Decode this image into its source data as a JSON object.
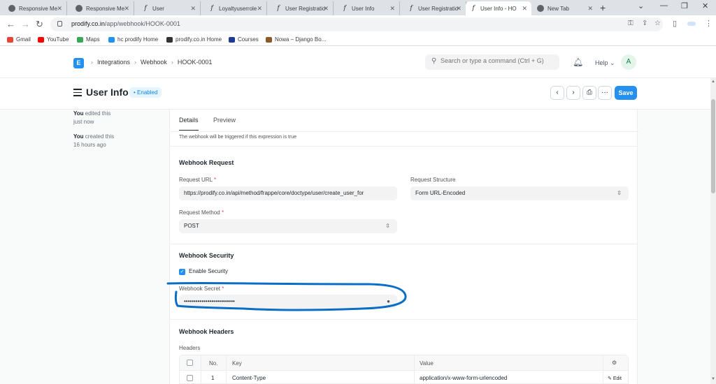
{
  "browser": {
    "tabs": [
      {
        "title": "Responsive Me",
        "icon": "globe-icon"
      },
      {
        "title": "Responsive Me",
        "icon": "globe-icon"
      },
      {
        "title": "User",
        "icon": "frappe-icon"
      },
      {
        "title": "Loyaltyuserrole",
        "icon": "frappe-icon"
      },
      {
        "title": "User Registratio",
        "icon": "frappe-icon"
      },
      {
        "title": "User Info",
        "icon": "frappe-icon"
      },
      {
        "title": "User Registratio",
        "icon": "frappe-icon"
      },
      {
        "title": "User Info - HO",
        "icon": "frappe-icon",
        "active": true
      },
      {
        "title": "New Tab",
        "icon": "chrome-icon"
      }
    ],
    "url_host": "prodify.co.in",
    "url_path": "/app/webhook/HOOK-0001",
    "bookmarks": [
      {
        "label": "Gmail",
        "color": "#ea4335"
      },
      {
        "label": "YouTube",
        "color": "#ff0000"
      },
      {
        "label": "Maps",
        "color": "#34a853"
      },
      {
        "label": "hc prodify Home",
        "color": "#2490ef"
      },
      {
        "label": "prodify.co.in Home",
        "color": "#333333"
      },
      {
        "label": "Courses",
        "color": "#1f3a93"
      },
      {
        "label": "Nowa – Django Bo...",
        "color": "#8b5a2b"
      }
    ]
  },
  "navbar": {
    "logo": "E",
    "breadcrumbs": [
      "Integrations",
      "Webhook",
      "HOOK-0001"
    ],
    "search_placeholder": "Search or type a command (Ctrl + G)",
    "help": "Help",
    "avatar": "A"
  },
  "page": {
    "title": "User Info",
    "status": "Enabled",
    "save_label": "Save"
  },
  "timeline": [
    {
      "who": "You",
      "action": "edited this",
      "when": "just now"
    },
    {
      "who": "You",
      "action": "created this",
      "when": "16 hours ago"
    }
  ],
  "form": {
    "tabs": [
      "Details",
      "Preview"
    ],
    "condition_note": "The webhook will be triggered if this expression is true",
    "request_section": "Webhook Request",
    "request_url_label": "Request URL",
    "request_url": "https://prodify.co.in/api/method/frappe/core/doctype/user/create_user_for",
    "request_structure_label": "Request Structure",
    "request_structure": "Form URL-Encoded",
    "request_method_label": "Request Method",
    "request_method": "POST",
    "security_section": "Webhook Security",
    "enable_security_label": "Enable Security",
    "secret_label": "Webhook Secret",
    "secret_value": "••••••••••••••••••••••••••",
    "headers_section": "Webhook Headers",
    "headers_label": "Headers",
    "table_columns": [
      "No.",
      "Key",
      "Value"
    ],
    "table_rows": [
      {
        "no": "1",
        "key": "Content-Type",
        "value": "application/x-www-form-urlencoded",
        "edit": "Edit"
      }
    ]
  },
  "colors": {
    "primary": "#2490ef",
    "annotation": "#0a6ec7"
  }
}
